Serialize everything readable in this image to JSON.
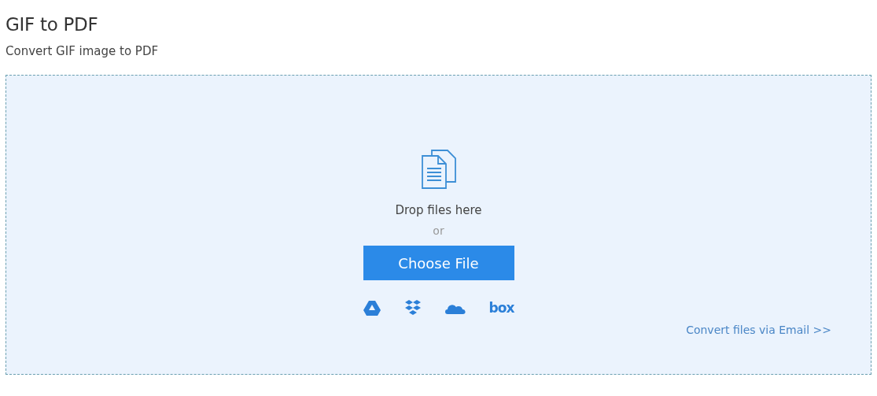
{
  "title": "GIF to PDF",
  "subtitle": "Convert GIF image to PDF",
  "dropzone": {
    "prompt": "Drop files here",
    "separator": "or",
    "button": "Choose File",
    "sources": [
      {
        "kind": "drive"
      },
      {
        "kind": "dropbox"
      },
      {
        "kind": "onedrive"
      },
      {
        "kind": "box",
        "label": "box"
      }
    ],
    "email_link": "Convert files via Email >>"
  }
}
